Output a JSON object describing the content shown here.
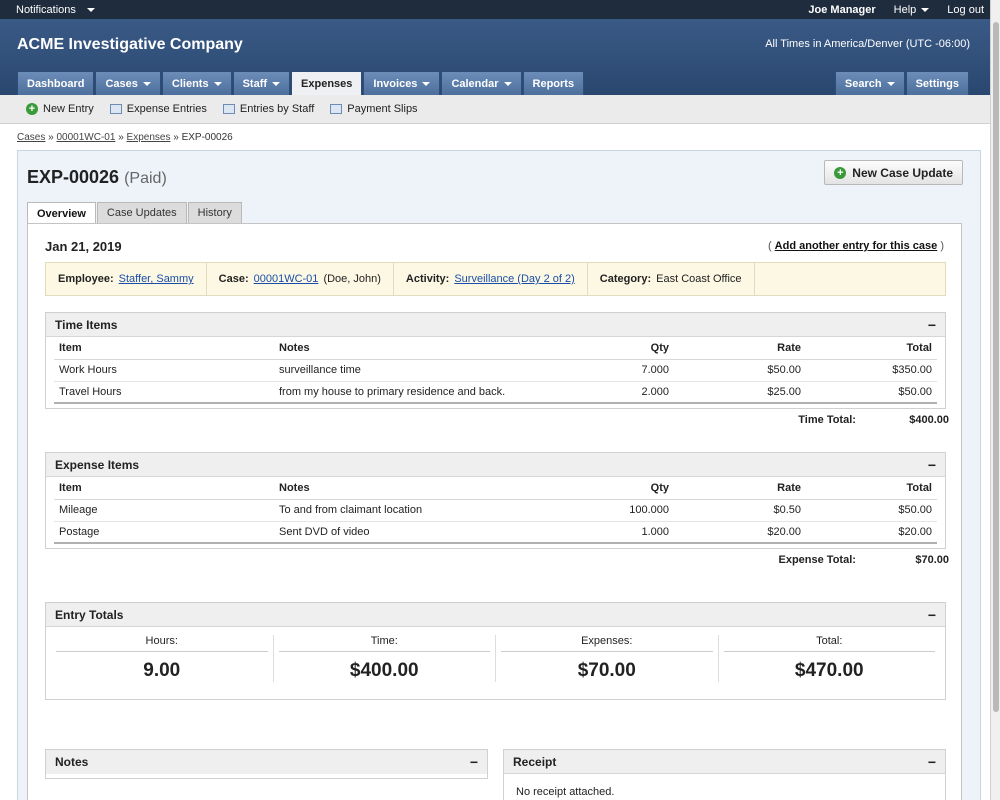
{
  "topbar": {
    "notifications": "Notifications",
    "user": "Joe Manager",
    "help": "Help",
    "logout": "Log out"
  },
  "header": {
    "company": "ACME Investigative Company",
    "timezone": "All Times in America/Denver (UTC -06:00)"
  },
  "nav": {
    "tabs": [
      "Dashboard",
      "Cases",
      "Clients",
      "Staff",
      "Expenses",
      "Invoices",
      "Calendar",
      "Reports"
    ],
    "right": [
      "Search",
      "Settings"
    ]
  },
  "subnav": {
    "new_entry": "New Entry",
    "expense_entries": "Expense Entries",
    "entries_by_staff": "Entries by Staff",
    "payment_slips": "Payment Slips"
  },
  "breadcrumb": {
    "cases": "Cases",
    "case": "00001WC-01",
    "expenses": "Expenses",
    "current": "EXP-00026",
    "sep": "»"
  },
  "page": {
    "title": "EXP-00026",
    "status": "(Paid)",
    "new_update": "New Case Update"
  },
  "tabs": [
    "Overview",
    "Case Updates",
    "History"
  ],
  "entry": {
    "date": "Jan 21, 2019",
    "add_link": "Add another entry for this case",
    "employee_label": "Employee:",
    "employee": "Staffer, Sammy",
    "case_label": "Case:",
    "case": "00001WC-01",
    "case_name": "(Doe, John)",
    "activity_label": "Activity:",
    "activity": "Surveillance (Day 2 of 2)",
    "category_label": "Category:",
    "category": "East Coast Office"
  },
  "time_items": {
    "title": "Time Items",
    "columns": [
      "Item",
      "Notes",
      "Qty",
      "Rate",
      "Total"
    ],
    "rows": [
      [
        "Work Hours",
        "surveillance time",
        "7.000",
        "$50.00",
        "$350.00"
      ],
      [
        "Travel Hours",
        "from my house to primary residence and back.",
        "2.000",
        "$25.00",
        "$50.00"
      ]
    ],
    "total_label": "Time Total:",
    "total": "$400.00"
  },
  "expense_items": {
    "title": "Expense Items",
    "columns": [
      "Item",
      "Notes",
      "Qty",
      "Rate",
      "Total"
    ],
    "rows": [
      [
        "Mileage",
        "To and from claimant location",
        "100.000",
        "$0.50",
        "$50.00"
      ],
      [
        "Postage",
        "Sent DVD of video",
        "1.000",
        "$20.00",
        "$20.00"
      ]
    ],
    "total_label": "Expense Total:",
    "total": "$70.00"
  },
  "entry_totals": {
    "title": "Entry Totals",
    "items": [
      {
        "label": "Hours:",
        "value": "9.00"
      },
      {
        "label": "Time:",
        "value": "$400.00"
      },
      {
        "label": "Expenses:",
        "value": "$70.00"
      },
      {
        "label": "Total:",
        "value": "$470.00"
      }
    ]
  },
  "notes": {
    "title": "Notes"
  },
  "receipt": {
    "title": "Receipt",
    "text": "No receipt attached."
  },
  "colors": {
    "header": "#29476f",
    "accent": "#1a4ea8"
  }
}
